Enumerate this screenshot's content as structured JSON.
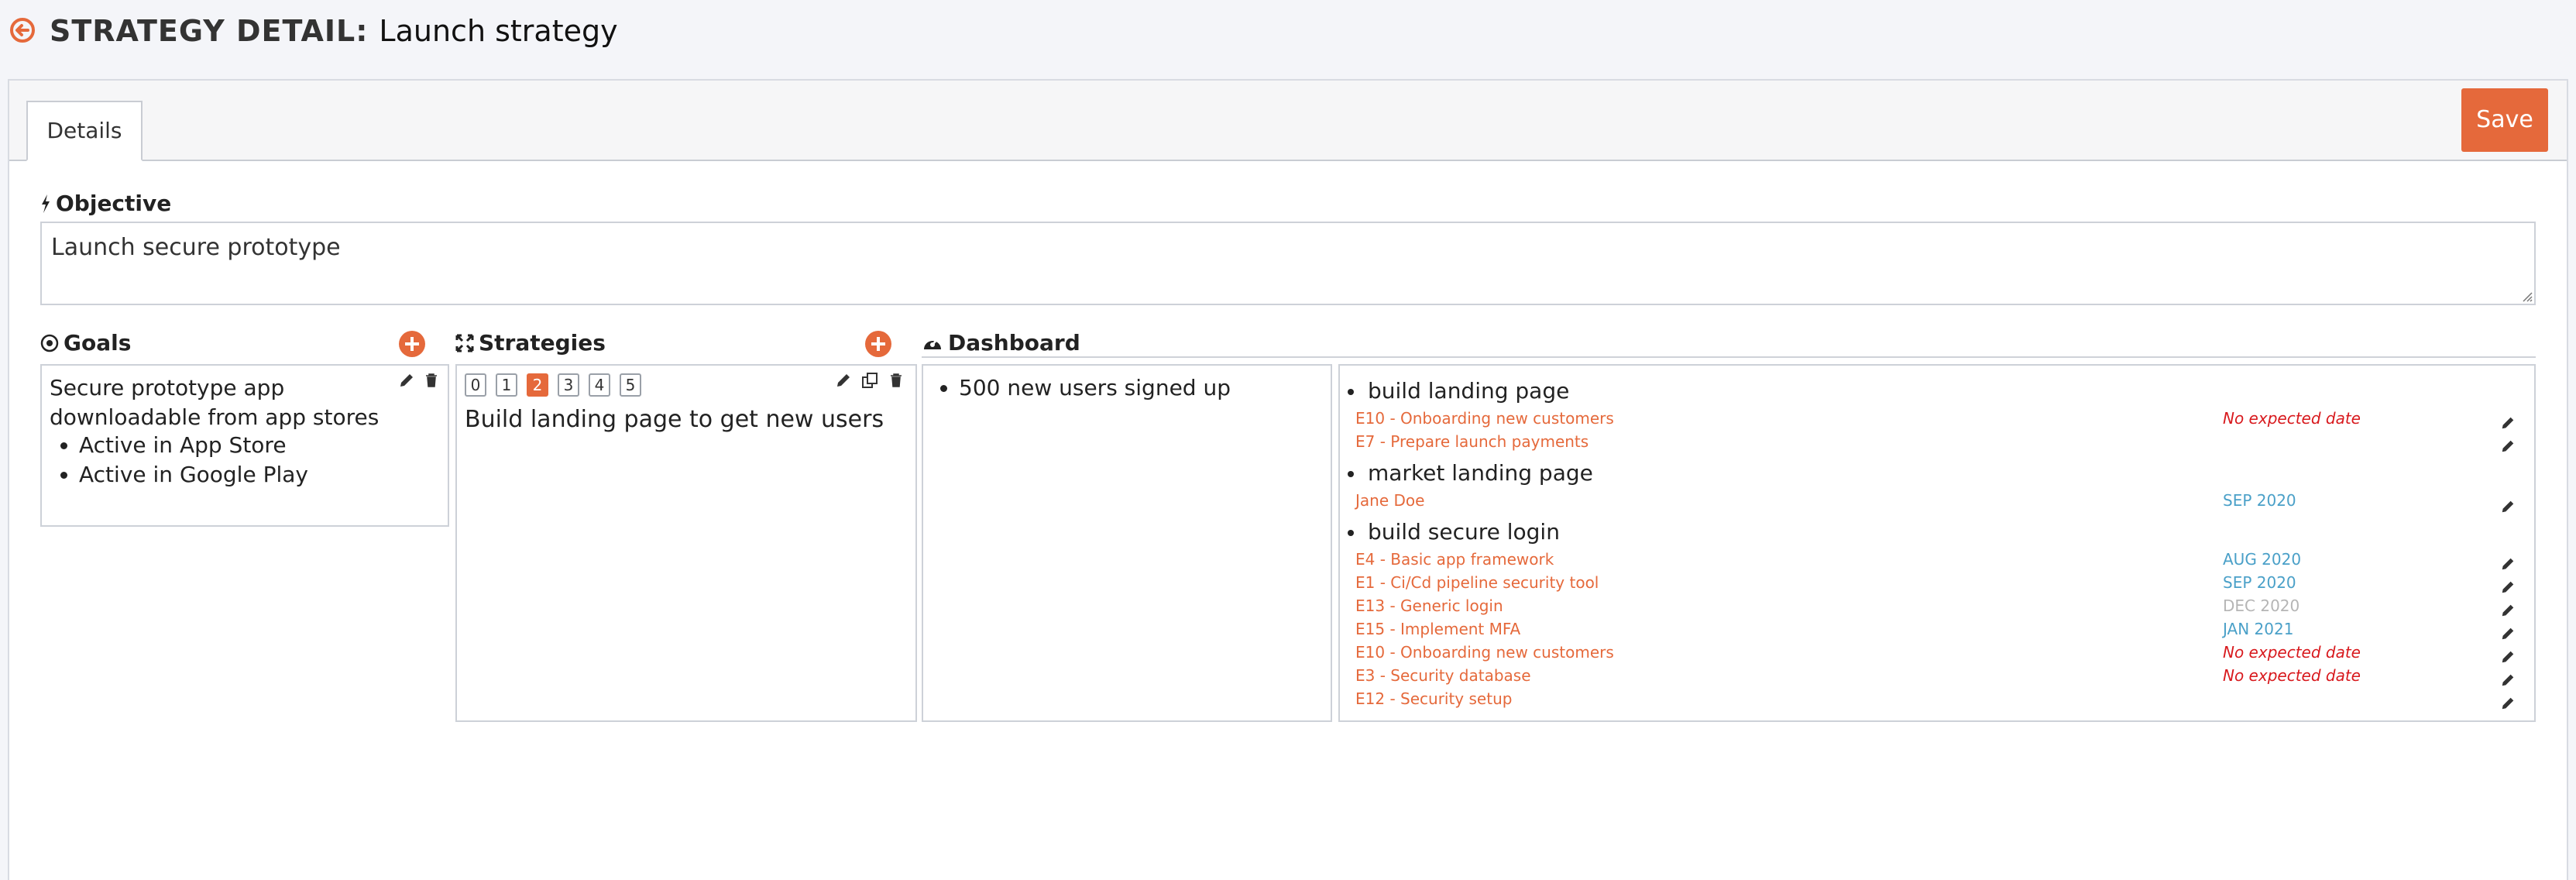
{
  "header": {
    "title_label": "STRATEGY DETAIL:",
    "title_value": "Launch strategy"
  },
  "tabs": [
    {
      "label": "Details"
    }
  ],
  "toolbar": {
    "save_label": "Save"
  },
  "objective": {
    "label": "Objective",
    "value": "Launch secure prototype"
  },
  "goals": {
    "label": "Goals",
    "items": [
      {
        "title": "Secure prototype app downloadable from app stores",
        "key_results": [
          "Active in App Store",
          "Active in Google Play"
        ]
      }
    ]
  },
  "strategies": {
    "label": "Strategies",
    "pages": [
      "0",
      "1",
      "2",
      "3",
      "4",
      "5"
    ],
    "active_page": "2",
    "current": "Build landing page to get new users"
  },
  "dashboard": {
    "label": "Dashboard",
    "kpis": [
      "500 new users signed up"
    ],
    "initiatives": [
      {
        "title": "build landing page",
        "epics": [
          {
            "name": "E10 - Onboarding new customers",
            "date": "No expected date",
            "status": "none"
          },
          {
            "name": "E7 - Prepare launch payments",
            "date": "",
            "status": "none"
          }
        ]
      },
      {
        "title": "market landing page",
        "epics": [
          {
            "name": "Jane Doe",
            "date": "SEP 2020",
            "status": "planned"
          }
        ]
      },
      {
        "title": "build secure login",
        "epics": [
          {
            "name": "E4 - Basic app framework",
            "date": "AUG 2020",
            "status": "planned"
          },
          {
            "name": "E1 - Ci/Cd pipeline security tool",
            "date": "SEP 2020",
            "status": "planned"
          },
          {
            "name": "E13 - Generic login",
            "date": "DEC 2020",
            "status": "past"
          },
          {
            "name": "E15 - Implement MFA",
            "date": "JAN 2021",
            "status": "planned"
          },
          {
            "name": "E10 - Onboarding new customers",
            "date": "No expected date",
            "status": "none"
          },
          {
            "name": "E3 - Security database",
            "date": "No expected date",
            "status": "none"
          },
          {
            "name": "E12 - Security setup",
            "date": "",
            "status": "none"
          }
        ]
      }
    ]
  },
  "colors": {
    "accent": "#e5693b",
    "no_date": "#d8191d",
    "planned": "#4aa0c8",
    "past": "#b5b5b5"
  },
  "icons": [
    "back-arrow-icon",
    "bolt-icon",
    "target-icon",
    "expand-icon",
    "dashboard-gauge-icon",
    "plus-circle-icon",
    "pencil-icon",
    "trash-icon",
    "copy-icon"
  ]
}
